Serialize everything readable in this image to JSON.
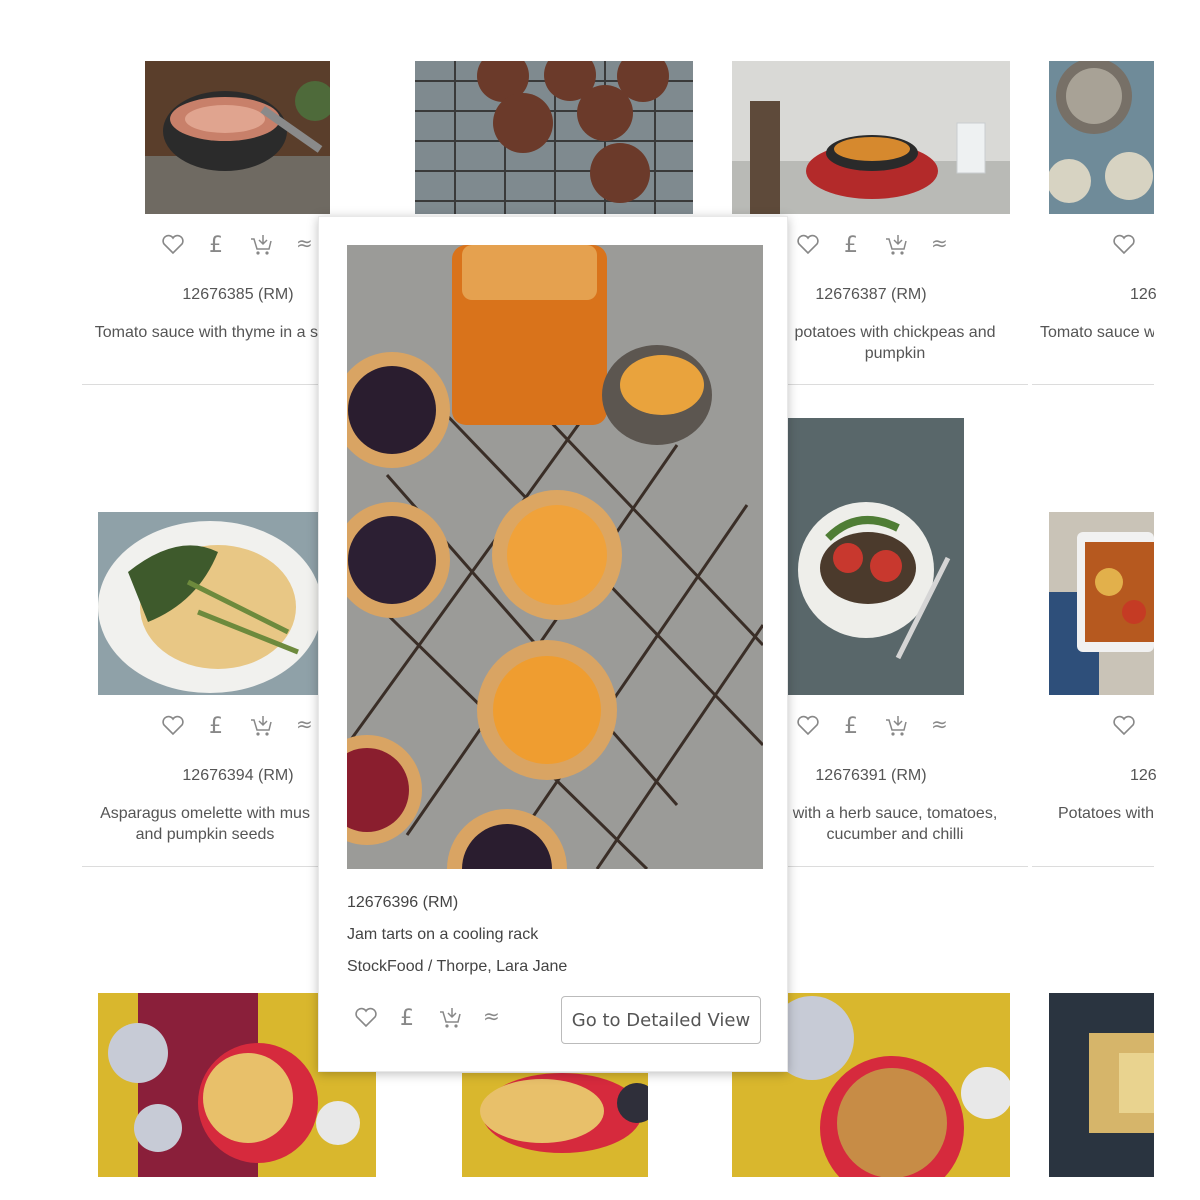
{
  "grid": {
    "row1": [
      {
        "id": "12676385 (RM)",
        "title": "Tomato sauce with thyme in a s"
      },
      {
        "id": "",
        "title": ""
      },
      {
        "id": "12676387 (RM)",
        "title": "potatoes with chickpeas and pumpkin"
      },
      {
        "id": "126",
        "title": "Tomato sauce w"
      }
    ],
    "row2": [
      {
        "id": "12676394 (RM)",
        "title": "Asparagus omelette with mus and pumpkin seeds"
      },
      {
        "id": "",
        "title": ""
      },
      {
        "id": "12676391 (RM)",
        "title": "with a herb sauce, tomatoes, cucumber and chilli"
      },
      {
        "id": "126",
        "title": "Potatoes with"
      }
    ]
  },
  "popup": {
    "id": "12676396 (RM)",
    "title": "Jam tarts on a cooling rack",
    "credit": "StockFood / Thorpe, Lara Jane",
    "detail_button": "Go to Detailed View"
  },
  "icons": [
    "heart-icon",
    "pound-icon",
    "cart-icon",
    "similar-icon"
  ]
}
